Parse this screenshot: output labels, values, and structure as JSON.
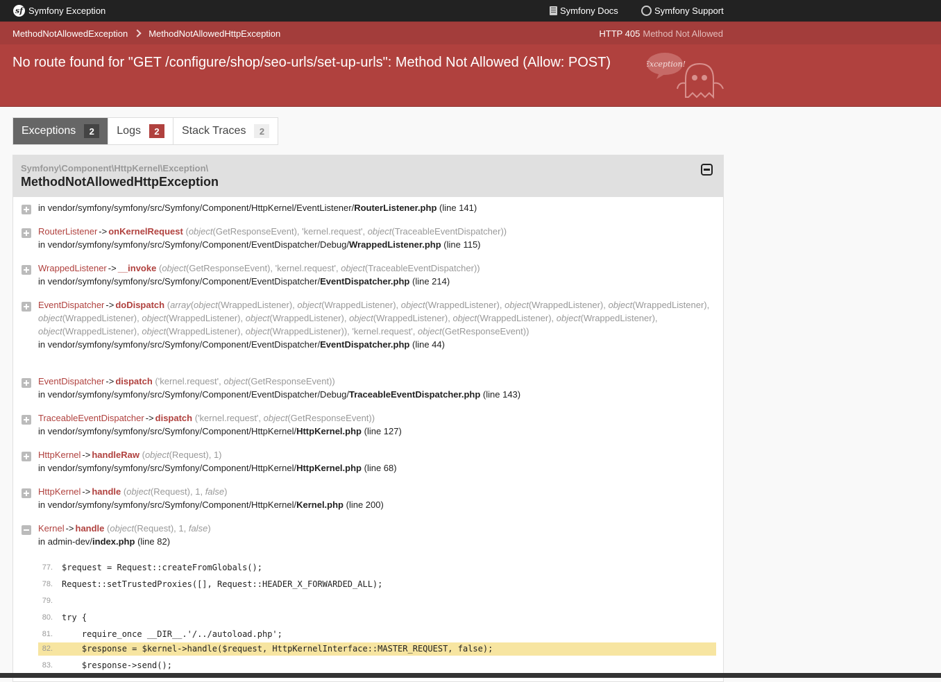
{
  "topbar": {
    "brand": "Symfony Exception",
    "docs": "Symfony Docs",
    "support": "Symfony Support"
  },
  "meta": {
    "crumb1": "MethodNotAllowedException",
    "crumb2": "MethodNotAllowedHttpException",
    "http_code": "HTTP 405",
    "http_text": "Method Not Allowed"
  },
  "message": "No route found for \"GET /configure/shop/seo-urls/set-up-urls\": Method Not Allowed (Allow: POST)",
  "ghost_text": "Exception!",
  "tabs": [
    {
      "label": "Exceptions",
      "count": "2"
    },
    {
      "label": "Logs",
      "count": "2"
    },
    {
      "label": "Stack Traces",
      "count": "2"
    }
  ],
  "exception": {
    "namespace": "Symfony\\Component\\HttpKernel\\Exception\\",
    "name": "MethodNotAllowedHttpException"
  },
  "traces": {
    "t0": {
      "in": "in vendor/symfony/symfony/src/Symfony/Component/HttpKernel/EventListener/",
      "file": "RouterListener.php",
      "line": "(line 141)"
    },
    "t1": {
      "cls": "RouterListener",
      "fn": "onKernelRequest",
      "args": "(object(GetResponseEvent), 'kernel.request', object(TraceableEventDispatcher))",
      "in": "in vendor/symfony/symfony/src/Symfony/Component/EventDispatcher/Debug/",
      "file": "WrappedListener.php",
      "line": "(line 115)"
    },
    "t2": {
      "cls": "WrappedListener",
      "fn": "__invoke",
      "args": "(object(GetResponseEvent), 'kernel.request', object(TraceableEventDispatcher))",
      "in": "in vendor/symfony/symfony/src/Symfony/Component/EventDispatcher/",
      "file": "EventDispatcher.php",
      "line": "(line 214)"
    },
    "t3": {
      "cls": "EventDispatcher",
      "fn": "doDispatch",
      "args": "(array(object(WrappedListener), object(WrappedListener), object(WrappedListener), object(WrappedListener), object(WrappedListener), object(WrappedListener), object(WrappedListener), object(WrappedListener), object(WrappedListener), object(WrappedListener), object(WrappedListener), object(WrappedListener), object(WrappedListener), object(WrappedListener)), 'kernel.request', object(GetResponseEvent))",
      "in": "in vendor/symfony/symfony/src/Symfony/Component/EventDispatcher/",
      "file": "EventDispatcher.php",
      "line": "(line 44)"
    },
    "t4": {
      "cls": "EventDispatcher",
      "fn": "dispatch",
      "args": "('kernel.request', object(GetResponseEvent))",
      "in": "in vendor/symfony/symfony/src/Symfony/Component/EventDispatcher/Debug/",
      "file": "TraceableEventDispatcher.php",
      "line": "(line 143)"
    },
    "t5": {
      "cls": "TraceableEventDispatcher",
      "fn": "dispatch",
      "args": "('kernel.request', object(GetResponseEvent))",
      "in": "in vendor/symfony/symfony/src/Symfony/Component/HttpKernel/",
      "file": "HttpKernel.php",
      "line": "(line 127)"
    },
    "t6": {
      "cls": "HttpKernel",
      "fn": "handleRaw",
      "args": "(object(Request), 1)",
      "in": "in vendor/symfony/symfony/src/Symfony/Component/HttpKernel/",
      "file": "HttpKernel.php",
      "line": "(line 68)"
    },
    "t7": {
      "cls": "HttpKernel",
      "fn": "handle",
      "args": "(object(Request), 1, false)",
      "in": "in vendor/symfony/symfony/src/Symfony/Component/HttpKernel/",
      "file": "Kernel.php",
      "line": "(line 200)"
    },
    "t8": {
      "cls": "Kernel",
      "fn": "handle",
      "args": "(object(Request), 1, false)",
      "in": "in admin-dev/",
      "file": "index.php",
      "line": "(line 82)"
    }
  },
  "code": [
    {
      "n": "77.",
      "src": "$request = Request::createFromGlobals();"
    },
    {
      "n": "78.",
      "src": "Request::setTrustedProxies([], Request::HEADER_X_FORWARDED_ALL);"
    },
    {
      "n": "79.",
      "src": ""
    },
    {
      "n": "80.",
      "src": "try {"
    },
    {
      "n": "81.",
      "src": "    require_once __DIR__.'/../autoload.php';"
    },
    {
      "n": "82.",
      "src": "    $response = $kernel->handle($request, HttpKernelInterface::MASTER_REQUEST, false);"
    },
    {
      "n": "83.",
      "src": "    $response->send();"
    }
  ],
  "arrow": "->",
  "colors": {
    "accent": "#b0413e",
    "topbar": "#222222",
    "highlight": "#f7e5a1"
  }
}
